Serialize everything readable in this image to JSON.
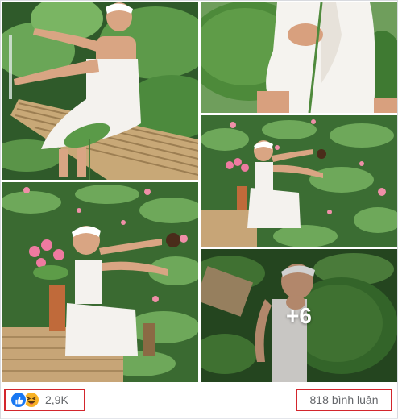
{
  "post": {
    "more_photos_label": "+6"
  },
  "footer": {
    "reaction_count": "2,9K",
    "reaction_icons": [
      "like-icon",
      "haha-icon"
    ],
    "comment_count": "818",
    "comment_label": "bình luận"
  },
  "colors": {
    "like_blue": "#1877f2",
    "haha_yellow": "#f7b125",
    "highlight_red": "#d3262d",
    "meta_text": "#65676b"
  }
}
